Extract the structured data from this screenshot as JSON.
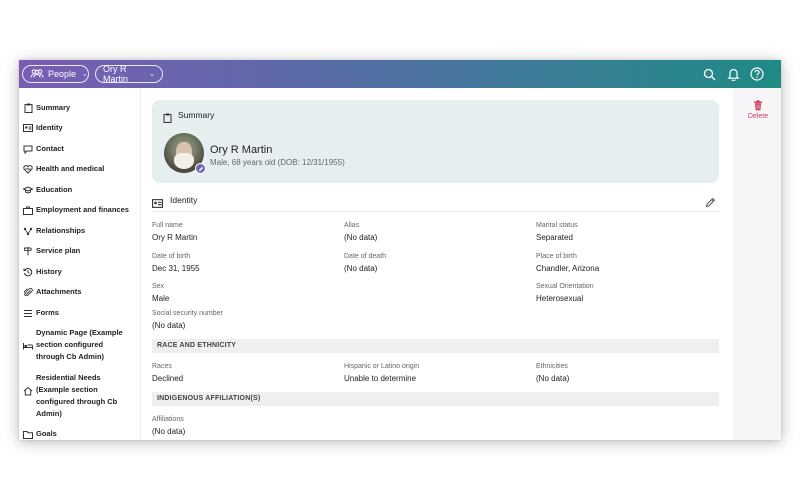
{
  "topbar": {
    "people_label": "People",
    "person_label": "Ory R Martin",
    "icons": [
      "people-icon",
      "search-icon",
      "bell-icon",
      "help-icon"
    ]
  },
  "sidebar": {
    "items": [
      {
        "label": "Summary",
        "icon": "clipboard-icon"
      },
      {
        "label": "Identity",
        "icon": "id-card-icon"
      },
      {
        "label": "Contact",
        "icon": "chat-icon"
      },
      {
        "label": "Health and medical",
        "icon": "heart-icon"
      },
      {
        "label": "Education",
        "icon": "graduation-cap-icon"
      },
      {
        "label": "Employment and finances",
        "icon": "briefcase-icon"
      },
      {
        "label": "Relationships",
        "icon": "network-icon"
      },
      {
        "label": "Service plan",
        "icon": "signpost-icon"
      },
      {
        "label": "History",
        "icon": "history-icon"
      },
      {
        "label": "Attachments",
        "icon": "paperclip-icon"
      },
      {
        "label": "Forms",
        "icon": "list-icon"
      },
      {
        "label": "Dynamic Page (Example section configured through Cb Admin)",
        "icon": "bed-icon"
      },
      {
        "label": "Residential Needs (Example section configured through Cb Admin)",
        "icon": "home-icon"
      },
      {
        "label": "Goals",
        "icon": "folder-icon"
      }
    ]
  },
  "actions": {
    "delete_label": "Delete"
  },
  "summary": {
    "title": "Summary",
    "name": "Ory R Martin",
    "meta": "Male, 68 years old (DOB: 12/31/1955)"
  },
  "identity": {
    "title": "Identity",
    "fields": {
      "full_name": {
        "label": "Full name",
        "value": "Ory R Martin"
      },
      "alias": {
        "label": "Alias",
        "value": "(No data)"
      },
      "marital_status": {
        "label": "Marital status",
        "value": "Separated"
      },
      "dob": {
        "label": "Date of birth",
        "value": "Dec 31, 1955"
      },
      "dod": {
        "label": "Date of death",
        "value": "(No data)"
      },
      "pob": {
        "label": "Place of birth",
        "value": "Chandler, Arizona"
      },
      "sex": {
        "label": "Sex",
        "value": "Male"
      },
      "orientation": {
        "label": "Sexual Orientation",
        "value": "Heterosexual"
      },
      "ssn": {
        "label": "Social security number",
        "value": "(No data)"
      }
    },
    "race_band": "RACE AND ETHNICITY",
    "race": {
      "races": {
        "label": "Races",
        "value": "Declined"
      },
      "hispanic": {
        "label": "Hispanic or Latino origin",
        "value": "Unable to determine"
      },
      "ethnicities": {
        "label": "Ethnicities",
        "value": "(No data)"
      }
    },
    "indigenous_band": "INDIGENOUS AFFILIATION(S)",
    "affiliations": {
      "label": "Affiliations",
      "value": "(No data)"
    }
  },
  "colors": {
    "gradient_start": "#7a5db3",
    "gradient_end": "#1f8a84",
    "delete": "#d23a57",
    "summary_card": "#e6eef0",
    "badge": "#6c6bb8"
  }
}
